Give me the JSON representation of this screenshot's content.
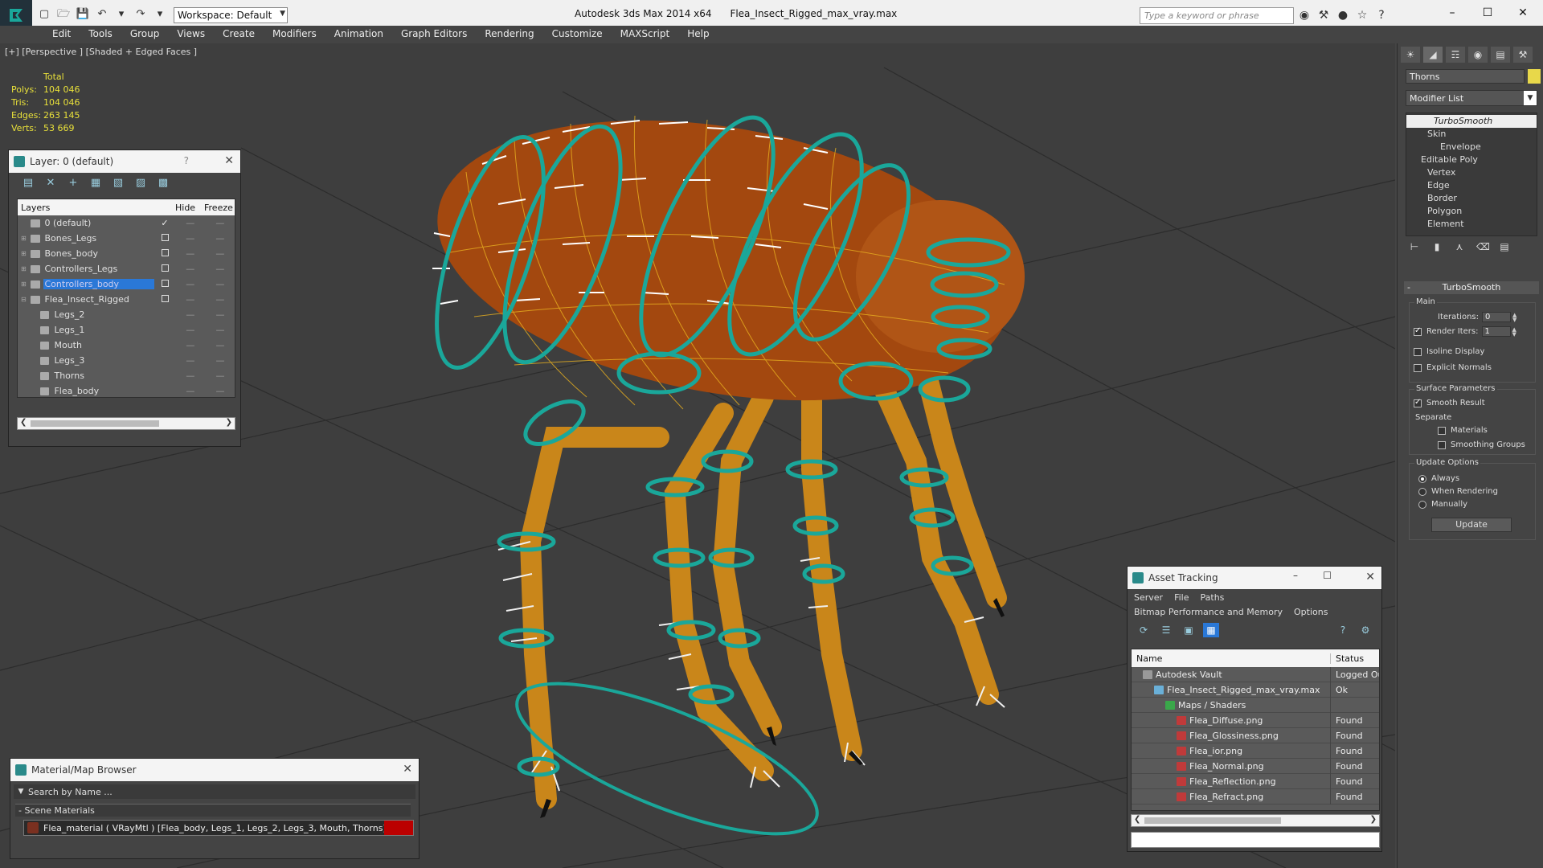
{
  "titlebar": {
    "app_title": "Autodesk 3ds Max  2014 x64",
    "file_name": "Flea_Insect_Rigged_max_vray.max",
    "workspace": "Workspace: Default",
    "search_placeholder": "Type a keyword or phrase"
  },
  "menu": [
    "Edit",
    "Tools",
    "Group",
    "Views",
    "Create",
    "Modifiers",
    "Animation",
    "Graph Editors",
    "Rendering",
    "Customize",
    "MAXScript",
    "Help"
  ],
  "viewport": {
    "label": "[+] [Perspective ] [Shaded + Edged Faces ]",
    "stats": {
      "header": "Total",
      "polys_label": "Polys:",
      "polys": "104 046",
      "tris_label": "Tris:",
      "tris": "104 046",
      "edges_label": "Edges:",
      "edges": "263 145",
      "verts_label": "Verts:",
      "verts": "53 669"
    }
  },
  "layer_panel": {
    "title": "Layer: 0 (default)",
    "help": "?",
    "columns": {
      "layers": "Layers",
      "hide": "Hide",
      "freeze": "Freeze"
    },
    "rows": [
      {
        "name": "0 (default)",
        "indent": 0,
        "current": true,
        "expand": ""
      },
      {
        "name": "Bones_Legs",
        "indent": 0,
        "expand": "+"
      },
      {
        "name": "Bones_body",
        "indent": 0,
        "expand": "+"
      },
      {
        "name": "Controllers_Legs",
        "indent": 0,
        "expand": "+"
      },
      {
        "name": "Controllers_body",
        "indent": 0,
        "expand": "+",
        "selected": true
      },
      {
        "name": "Flea_Insect_Rigged",
        "indent": 0,
        "expand": "-"
      },
      {
        "name": "Legs_2",
        "indent": 1,
        "expand": ""
      },
      {
        "name": "Legs_1",
        "indent": 1,
        "expand": ""
      },
      {
        "name": "Mouth",
        "indent": 1,
        "expand": ""
      },
      {
        "name": "Legs_3",
        "indent": 1,
        "expand": ""
      },
      {
        "name": "Thorns",
        "indent": 1,
        "expand": ""
      },
      {
        "name": "Flea_body",
        "indent": 1,
        "expand": ""
      }
    ]
  },
  "material_browser": {
    "title": "Material/Map Browser",
    "search": "Search by Name ...",
    "group": "- Scene Materials",
    "item": "Flea_material  ( VRayMtl )  [Flea_body, Legs_1, Legs_2, Legs_3, Mouth, Thorns]"
  },
  "asset_tracking": {
    "title": "Asset Tracking",
    "menu1": [
      "Server",
      "File",
      "Paths"
    ],
    "menu2": [
      "Bitmap Performance and Memory",
      "Options"
    ],
    "columns": {
      "name": "Name",
      "status": "Status"
    },
    "rows": [
      {
        "name": "Autodesk Vault",
        "status": "Logged Out",
        "indent": 1,
        "icon_color": "#999999"
      },
      {
        "name": "Flea_Insect_Rigged_max_vray.max",
        "status": "Ok",
        "indent": 2,
        "icon_color": "#6ab0d8"
      },
      {
        "name": "Maps / Shaders",
        "status": "",
        "indent": 3,
        "icon_color": "#3aa84a"
      },
      {
        "name": "Flea_Diffuse.png",
        "status": "Found",
        "indent": 4,
        "icon_color": "#c03a3a"
      },
      {
        "name": "Flea_Glossiness.png",
        "status": "Found",
        "indent": 4,
        "icon_color": "#c03a3a"
      },
      {
        "name": "Flea_ior.png",
        "status": "Found",
        "indent": 4,
        "icon_color": "#c03a3a"
      },
      {
        "name": "Flea_Normal.png",
        "status": "Found",
        "indent": 4,
        "icon_color": "#c03a3a"
      },
      {
        "name": "Flea_Reflection.png",
        "status": "Found",
        "indent": 4,
        "icon_color": "#c03a3a"
      },
      {
        "name": "Flea_Refract.png",
        "status": "Found",
        "indent": 4,
        "icon_color": "#c03a3a"
      }
    ]
  },
  "command_panel": {
    "object_name": "Thorns",
    "object_color": "#e8d84a",
    "modifier_list": "Modifier List",
    "stack": [
      {
        "label": "TurboSmooth",
        "indent": 0,
        "top": true
      },
      {
        "label": "Skin",
        "indent": 1
      },
      {
        "label": "Envelope",
        "indent": 2
      },
      {
        "label": "Editable Poly",
        "indent": 0
      },
      {
        "label": "Vertex",
        "indent": 1
      },
      {
        "label": "Edge",
        "indent": 1
      },
      {
        "label": "Border",
        "indent": 1
      },
      {
        "label": "Polygon",
        "indent": 1
      },
      {
        "label": "Element",
        "indent": 1
      }
    ],
    "turbosmooth": {
      "title": "TurboSmooth",
      "main": "Main",
      "iterations_label": "Iterations:",
      "iterations": "0",
      "render_iters_label": "Render Iters:",
      "render_iters": "1",
      "isoline": "Isoline Display",
      "explicit_normals": "Explicit Normals",
      "surface_params": "Surface Parameters",
      "smooth_result": "Smooth Result",
      "separate": "Separate",
      "materials": "Materials",
      "smoothing_groups": "Smoothing Groups",
      "update_options": "Update Options",
      "always": "Always",
      "when_rendering": "When Rendering",
      "manually": "Manually",
      "update": "Update"
    }
  },
  "colors": {
    "viewport_bg": "#3e3e3e",
    "flea_body": "#b85a10",
    "wire": "#e8b020",
    "controllers": "#1aa79a",
    "selection": "#2a78d7"
  }
}
